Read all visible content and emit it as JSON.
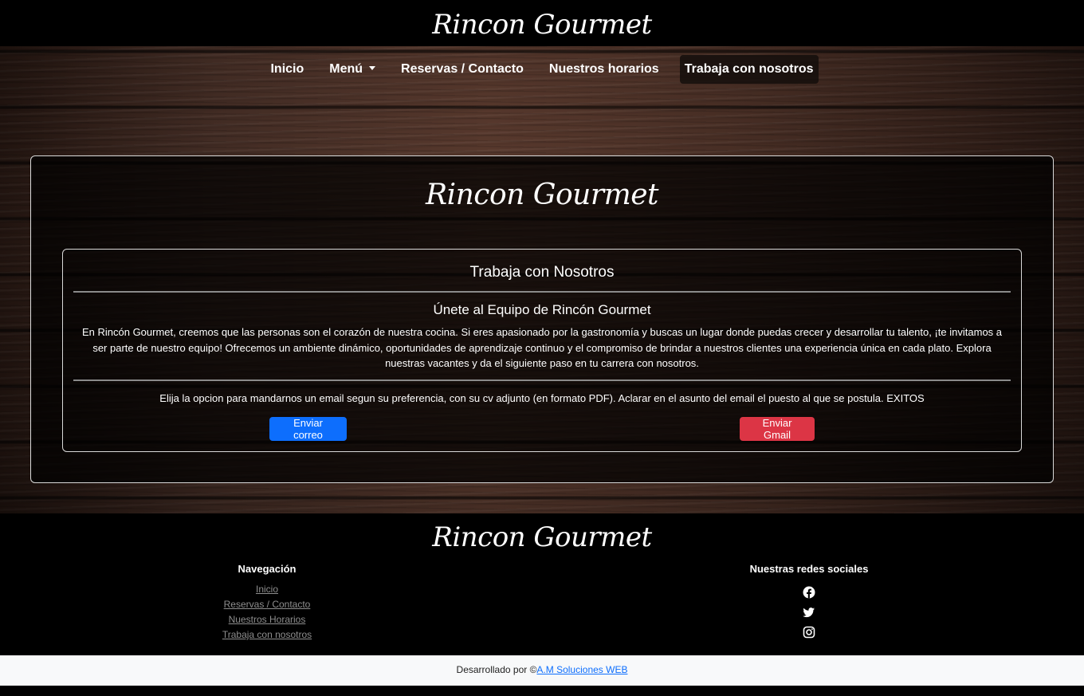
{
  "brand": "Rincon Gourmet",
  "nav": {
    "items": [
      {
        "label": "Inicio"
      },
      {
        "label": "Menú"
      },
      {
        "label": "Reservas / Contacto"
      },
      {
        "label": "Nuestros horarios"
      },
      {
        "label": "Trabaja con nosotros"
      }
    ],
    "active": "Trabaja con nosotros"
  },
  "main": {
    "card_title": "Trabaja con Nosotros",
    "subtitle": "Únete al Equipo de Rincón Gourmet",
    "description": "En Rincón Gourmet, creemos que las personas son el corazón de nuestra cocina. Si eres apasionado por la gastronomía y buscas un lugar donde puedas crecer y desarrollar tu talento, ¡te invitamos a ser parte de nuestro equipo! Ofrecemos un ambiente dinámico, oportunidades de aprendizaje continuo y el compromiso de brindar a nuestros clientes una experiencia única en cada plato. Explora nuestras vacantes y da el siguiente paso en tu carrera con nosotros.",
    "instructions": "Elija la opcion para mandarnos un email segun su preferencia, con su cv adjunto (en formato PDF). Aclarar en el asunto del email el puesto al que se postula. EXITOS",
    "buttons": {
      "email": "Enviar correo",
      "gmail": "Enviar Gmail"
    }
  },
  "footer": {
    "nav_heading": "Navegación",
    "links": [
      "Inicio",
      "Reservas / Contacto",
      "Nuestros Horarios",
      "Trabaja con nosotros"
    ],
    "social_heading": "Nuestras redes sociales",
    "social_icons": [
      "facebook-icon",
      "twitter-icon",
      "instagram-icon"
    ]
  },
  "credit": {
    "prefix": "Desarrollado por ©",
    "link": "A.M Soluciones WEB"
  },
  "colors": {
    "primary_button": "#0d6efd",
    "danger_button": "#dc3545",
    "footer_bg": "#000000",
    "credit_bg": "#f8f9fa"
  }
}
